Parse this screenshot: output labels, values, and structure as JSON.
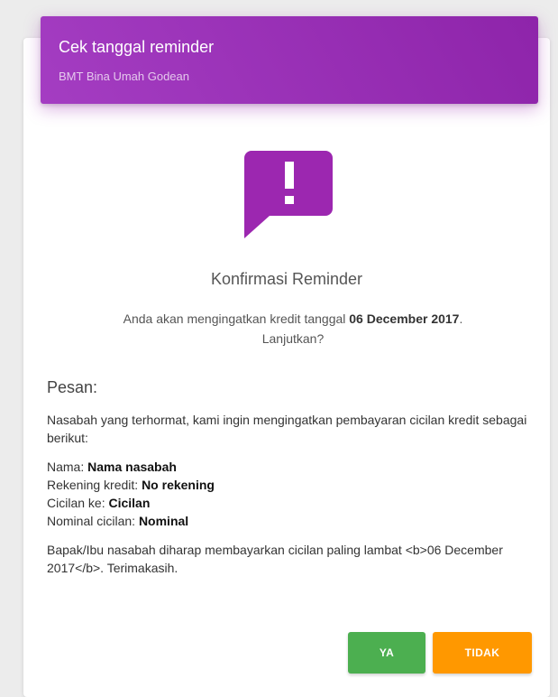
{
  "header": {
    "title": "Cek tanggal reminder",
    "subtitle": "BMT Bina Umah Godean"
  },
  "icon": {
    "name": "alert-speech-bubble-icon",
    "glyph": "!"
  },
  "colors": {
    "header": "#9c27b0",
    "icon": "#9c27b0",
    "yes_button": "#4caf50",
    "no_button": "#ff9800"
  },
  "confirm": {
    "title": "Konfirmasi Reminder",
    "text_before": "Anda akan mengingatkan kredit tanggal ",
    "date": "06 December 2017",
    "text_after": ".",
    "question": "Lanjutkan?"
  },
  "message": {
    "heading": "Pesan:",
    "intro": "Nasabah yang terhormat, kami ingin mengingatkan pembayaran cicilan kredit sebagai berikut:",
    "details": [
      {
        "label": "Nama: ",
        "value": "Nama nasabah"
      },
      {
        "label": "Rekening kredit: ",
        "value": "No rekening"
      },
      {
        "label": "Cicilan ke: ",
        "value": "Cicilan"
      },
      {
        "label": "Nominal cicilan: ",
        "value": "Nominal"
      }
    ],
    "closing": "Bapak/Ibu nasabah diharap membayarkan cicilan paling lambat <b>06 December 2017</b>. Terimakasih."
  },
  "buttons": {
    "yes": "YA",
    "no": "TIDAK"
  }
}
